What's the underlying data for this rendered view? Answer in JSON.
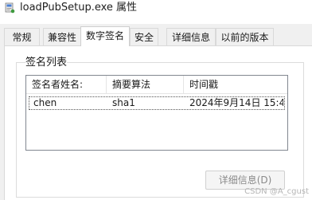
{
  "window": {
    "title": "loadPubSetup.exe 属性",
    "icon": "installer-icon"
  },
  "tabs": [
    {
      "label": "常规",
      "active": false
    },
    {
      "label": "兼容性",
      "active": false
    },
    {
      "label": "数字签名",
      "active": true
    },
    {
      "label": "安全",
      "active": false
    },
    {
      "label": "详细信息",
      "active": false
    },
    {
      "label": "以前的版本",
      "active": false
    }
  ],
  "signature_list": {
    "label": "签名列表",
    "columns": [
      "签名者姓名:",
      "摘要算法",
      "时间戳"
    ],
    "rows": [
      {
        "name": "chen",
        "algorithm": "sha1",
        "timestamp": "2024年9月14日 15:4..."
      }
    ]
  },
  "details_button": {
    "label": "详细信息(D)",
    "enabled": false
  },
  "watermark": "CSDN @A_cgust",
  "colors": {
    "window_bg": "#f0f0f0",
    "panel_bg": "#ffffff",
    "disabled_text": "#8a8a8a"
  }
}
